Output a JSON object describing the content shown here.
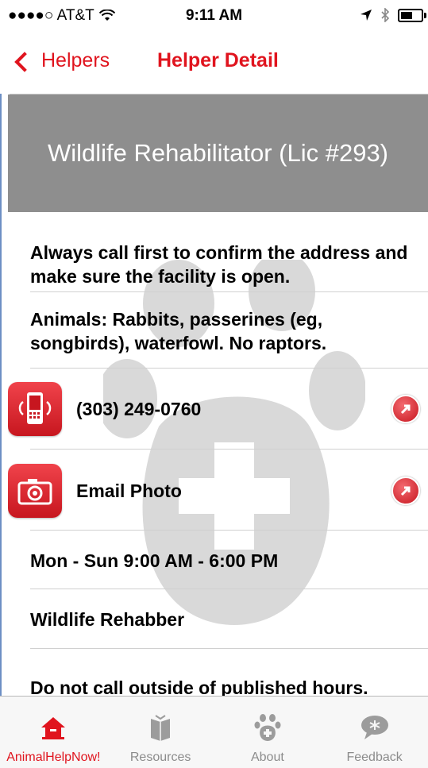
{
  "status_bar": {
    "carrier": "●●●●○ AT&T",
    "time": "9:11 AM"
  },
  "nav": {
    "back_label": "Helpers",
    "title": "Helper Detail"
  },
  "header": {
    "title": "Wildlife Rehabilitator (Lic #293)"
  },
  "detail": {
    "notice": "Always call first to confirm the address and make sure the facility is open.",
    "animals": "Animals: Rabbits, passerines (eg, songbirds), waterfowl. No raptors.",
    "phone": "(303) 249-0760",
    "email_label": "Email Photo",
    "hours": "Mon - Sun 9:00 AM - 6:00 PM",
    "type": "Wildlife Rehabber",
    "warning": "Do not call outside of published hours."
  },
  "tabs": [
    {
      "label": "AnimalHelpNow!",
      "icon": "home-icon",
      "active": true
    },
    {
      "label": "Resources",
      "icon": "book-icon",
      "active": false
    },
    {
      "label": "About",
      "icon": "paw-icon",
      "active": false
    },
    {
      "label": "Feedback",
      "icon": "speech-bubble-icon",
      "active": false
    }
  ],
  "colors": {
    "accent": "#e0141e",
    "header_band": "#8e8e8e",
    "tab_inactive": "#8c8c8c"
  }
}
